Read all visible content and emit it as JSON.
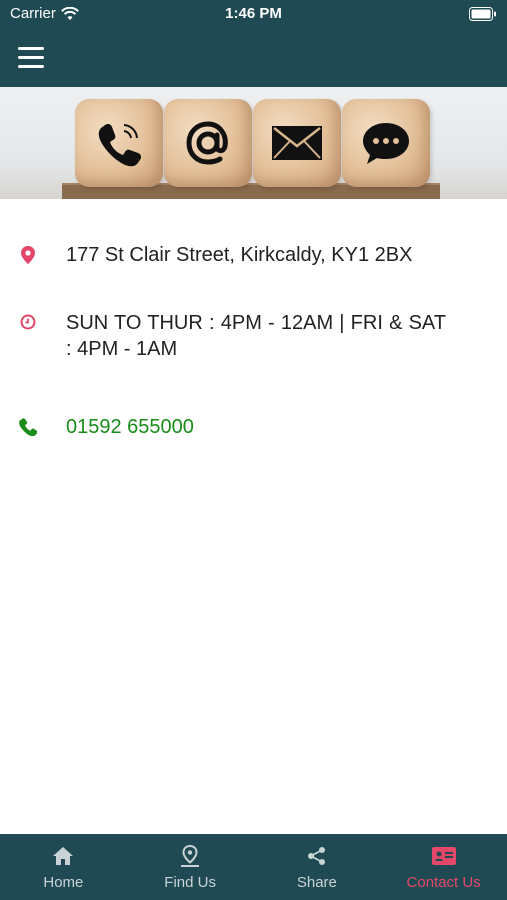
{
  "status_bar": {
    "carrier": "Carrier",
    "time": "1:46 PM"
  },
  "app_bar": {
    "menu_icon": "hamburger-menu-icon"
  },
  "hero": {
    "icons": [
      "phone-icon",
      "at-sign-icon",
      "envelope-icon",
      "chat-bubble-icon"
    ]
  },
  "contact": {
    "address": "177 St Clair Street, Kirkcaldy, KY1 2BX",
    "hours": "SUN TO THUR : 4PM - 12AM | FRI & SAT : 4PM - 1AM",
    "phone": "01592 655000"
  },
  "colors": {
    "primary": "#1f4a53",
    "accent": "#e5476a",
    "phone": "#1a8c1a"
  },
  "tabs": [
    {
      "label": "Home",
      "icon": "home-icon"
    },
    {
      "label": "Find Us",
      "icon": "location-pin-icon"
    },
    {
      "label": "Share",
      "icon": "share-icon"
    },
    {
      "label": "Contact Us",
      "icon": "contact-card-icon",
      "active": true
    }
  ]
}
